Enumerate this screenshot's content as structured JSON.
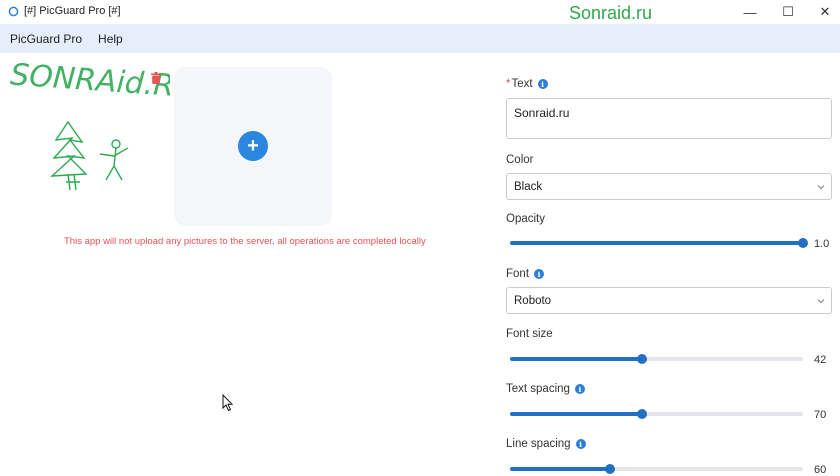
{
  "window": {
    "title": "[#] PicGuard Pro [#]",
    "watermark": "Sonraid.ru",
    "minimize_glyph": "—",
    "maximize_glyph": "☐",
    "close_glyph": "✕"
  },
  "menu": {
    "items": [
      "PicGuard Pro",
      "Help"
    ]
  },
  "upload": {
    "plus_glyph": "+",
    "notice": "This app will not upload any pictures to the server, all operations are completed locally",
    "sketch_text": "SONRAid.Ru"
  },
  "form": {
    "text": {
      "required_mark": "*",
      "label": "Text",
      "value": "Sonraid.ru"
    },
    "color": {
      "label": "Color",
      "value": "Black"
    },
    "opacity": {
      "label": "Opacity",
      "value": "1.0",
      "level": 1.0
    },
    "font": {
      "label": "Font",
      "value": "Roboto"
    },
    "font_size": {
      "label": "Font size",
      "value": "42",
      "level": 0.45
    },
    "text_spacing": {
      "label": "Text spacing",
      "value": "70",
      "level": 0.45
    },
    "line_spacing": {
      "label": "Line spacing",
      "value": "60",
      "level": 0.34
    }
  },
  "colors": {
    "accent": "#2370c3",
    "plus_button": "#2b86e0",
    "notice": "#e55353",
    "menubar": "#e6eefb",
    "watermark": "#2ea84a",
    "sketch": "#2eaa52"
  },
  "icons": {
    "app": "shield-app-icon",
    "delete": "trash-icon",
    "info": "info-icon",
    "dropdown": "chevron-down-icon",
    "cursor": "mouse-pointer-icon"
  }
}
